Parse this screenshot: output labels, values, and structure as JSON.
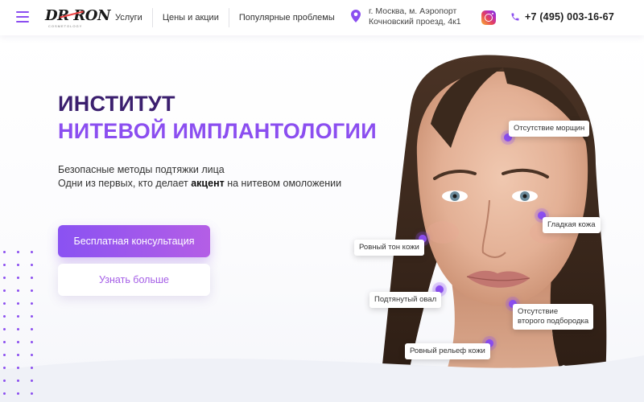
{
  "header": {
    "logo": "DR RON",
    "logo_sub": "COSMETOLOGY",
    "nav": [
      "Услуги",
      "Цены и акции",
      "Популярные проблемы"
    ],
    "address_line1": "г. Москва, м. Аэропорт",
    "address_line2": "Кочновский проезд, 4к1",
    "phone": "+7 (495) 003-16-67"
  },
  "hero": {
    "title_line1": "ИНСТИТУТ",
    "title_line2": "НИТЕВОЙ ИМПЛАНТОЛОГИИ",
    "subtitle_line1": "Безопасные методы подтяжки лица",
    "subtitle_line2_before": "Одни из первых, кто делает ",
    "subtitle_line2_bold": "акцент",
    "subtitle_line2_after": " на нитевом омоложении",
    "primary_button": "Бесплатная консультация",
    "secondary_button": "Узнать больше"
  },
  "callouts": {
    "wrinkles": "Отсутствие морщин",
    "smooth_skin": "Гладкая кожа",
    "even_tone": "Ровный тон кожи",
    "tight_oval": "Подтянутый овал",
    "no_double_chin_1": "Отсутствие",
    "no_double_chin_2": "второго подбородка",
    "even_relief": "Ровный рельеф кожи"
  },
  "colors": {
    "accent": "#8b4ef0",
    "title_dark": "#3b1f6e",
    "button_gradient_end": "#b45ee6"
  },
  "icons": [
    "menu-icon",
    "location-pin-icon",
    "instagram-icon",
    "phone-icon"
  ]
}
